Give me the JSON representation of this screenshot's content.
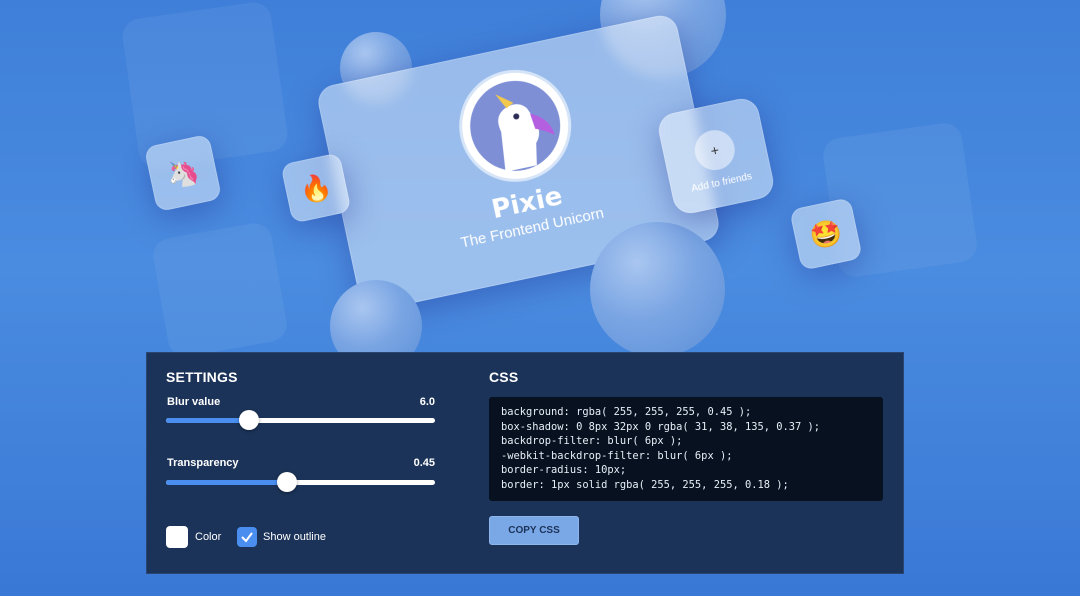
{
  "preview": {
    "card": {
      "name": "Pixie",
      "tagline": "The Frontend Unicorn"
    },
    "friends": {
      "icon": "plus-icon",
      "label": "Add to friends",
      "glyph": "+"
    },
    "emojis": {
      "unicorn": "🦄",
      "fire": "🔥",
      "star_struck": "🤩"
    }
  },
  "settings": {
    "title": "SETTINGS",
    "blur": {
      "label": "Blur value",
      "value": "6.0",
      "fraction": 0.31
    },
    "transparency": {
      "label": "Transparency",
      "value": "0.45",
      "fraction": 0.45
    },
    "color_label": "Color",
    "show_outline_label": "Show outline",
    "show_outline_checked": true
  },
  "css": {
    "title": "CSS",
    "lines": [
      "background: rgba( 255, 255, 255, 0.45 );",
      "box-shadow: 0 8px 32px 0 rgba( 31, 38, 135, 0.37 );",
      "backdrop-filter: blur( 6px );",
      "-webkit-backdrop-filter: blur( 6px );",
      "border-radius: 10px;",
      "border: 1px solid rgba( 255, 255, 255, 0.18 );"
    ],
    "copy_label": "COPY CSS"
  },
  "colors": {
    "background": "#4a8ce0",
    "panel": "#1b3358",
    "accent": "#4a8ff0",
    "code_bg": "#07111f"
  }
}
